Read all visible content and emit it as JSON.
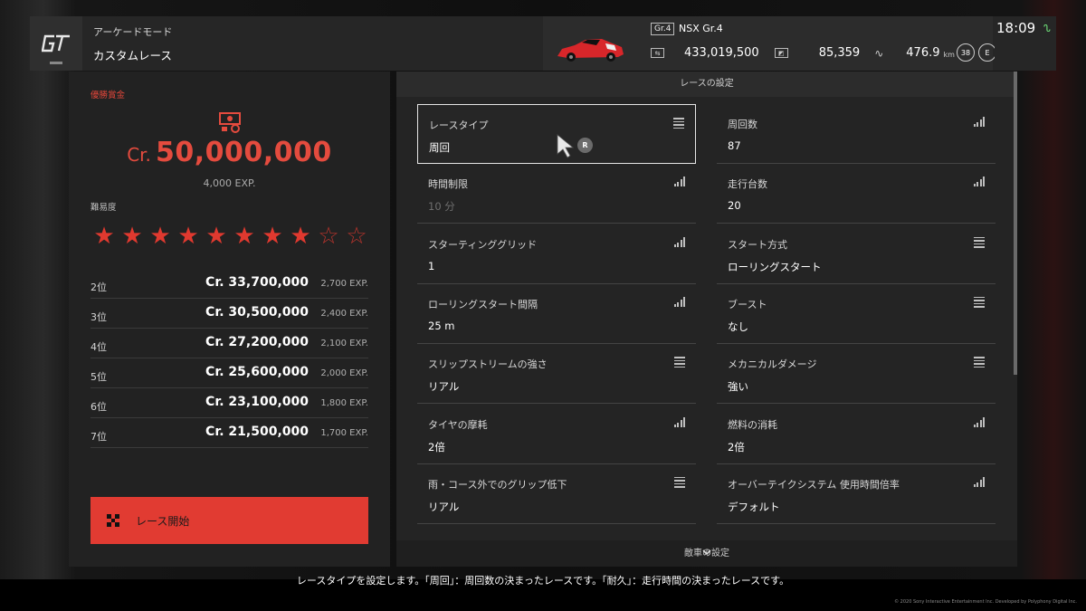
{
  "header": {
    "mode_line1": "アーケードモード",
    "mode_line2": "カスタムレース",
    "car_class": "Gr.4",
    "car_name": "NSX Gr.4",
    "credits": "433,019,500",
    "mileage_points": "85,359",
    "distance": "476.9",
    "distance_unit": "km",
    "level": "38",
    "license_badge": "E",
    "time": "18:09"
  },
  "left": {
    "prize_label": "優勝賞金",
    "prize_cr": "Cr.",
    "prize_amount": "50,000,000",
    "prize_exp": "4,000 EXP.",
    "difficulty_label": "難易度",
    "difficulty_stars": 8,
    "difficulty_max": 10,
    "ranks": [
      {
        "pos": "2位",
        "amount": "Cr. 33,700,000",
        "exp": "2,700 EXP."
      },
      {
        "pos": "3位",
        "amount": "Cr. 30,500,000",
        "exp": "2,400 EXP."
      },
      {
        "pos": "4位",
        "amount": "Cr. 27,200,000",
        "exp": "2,100 EXP."
      },
      {
        "pos": "5位",
        "amount": "Cr. 25,600,000",
        "exp": "2,000 EXP."
      },
      {
        "pos": "6位",
        "amount": "Cr. 23,100,000",
        "exp": "1,800 EXP."
      },
      {
        "pos": "7位",
        "amount": "Cr. 21,500,000",
        "exp": "1,700 EXP."
      }
    ],
    "start_button": "レース開始"
  },
  "right": {
    "title": "レースの設定",
    "settings": [
      {
        "label": "レースタイプ",
        "value": "周回",
        "icon": "list"
      },
      {
        "label": "周回数",
        "value": "87",
        "icon": "bars"
      },
      {
        "label": "時間制限",
        "value": "10 分",
        "icon": "bars"
      },
      {
        "label": "走行台数",
        "value": "20",
        "icon": "bars"
      },
      {
        "label": "スターティンググリッド",
        "value": "1",
        "icon": "bars"
      },
      {
        "label": "スタート方式",
        "value": "ローリングスタート",
        "icon": "list"
      },
      {
        "label": "ローリングスタート間隔",
        "value": "25 m",
        "icon": "bars"
      },
      {
        "label": "ブースト",
        "value": "なし",
        "icon": "list"
      },
      {
        "label": "スリップストリームの強さ",
        "value": "リアル",
        "icon": "list"
      },
      {
        "label": "メカニカルダメージ",
        "value": "強い",
        "icon": "list"
      },
      {
        "label": "タイヤの摩耗",
        "value": "2倍",
        "icon": "bars"
      },
      {
        "label": "燃料の消耗",
        "value": "2倍",
        "icon": "bars"
      },
      {
        "label": "雨・コース外でのグリップ低下",
        "value": "リアル",
        "icon": "list"
      },
      {
        "label": "オーバーテイクシステム 使用時間倍率",
        "value": "デフォルト",
        "icon": "bars"
      }
    ],
    "r_button": "R",
    "next_section": "敵車の設定"
  },
  "hint": "レースタイプを設定します。「周回」：周回数の決まったレースです。「耐久」：走行時間の決まったレースです。",
  "copyright": "© 2020 Sony Interactive Entertainment Inc. Developed by Polyphony Digital Inc.",
  "colors": {
    "accent": "#e13b32",
    "signal": "#6fe27a"
  }
}
